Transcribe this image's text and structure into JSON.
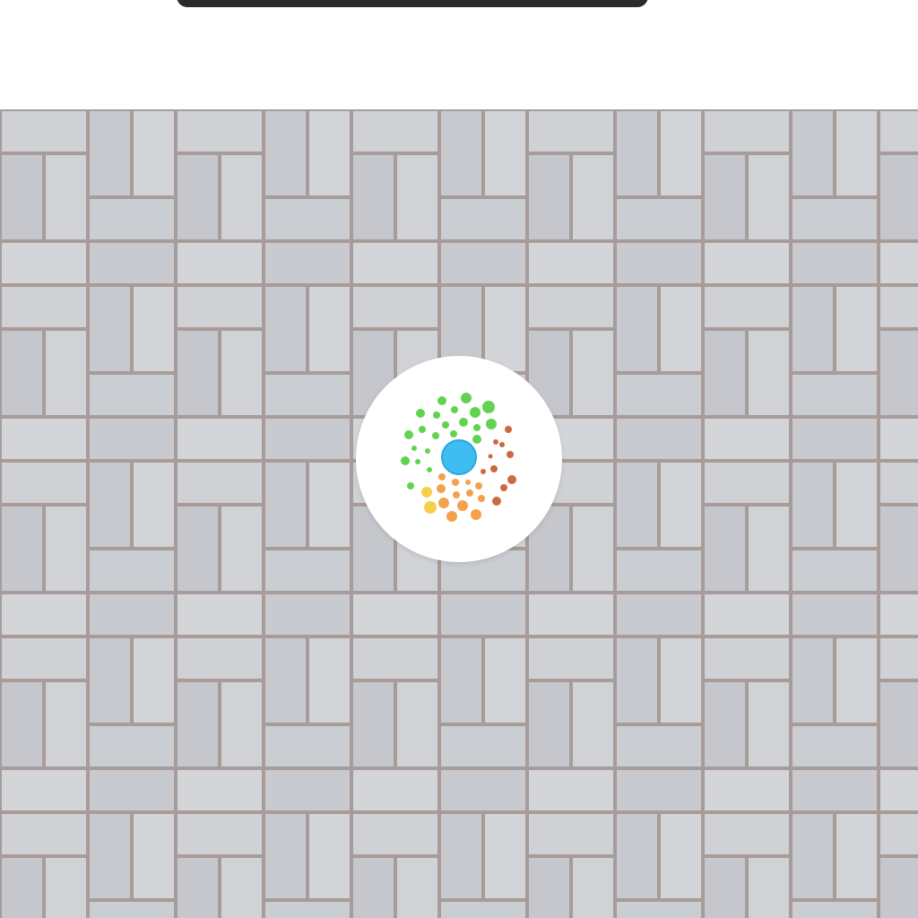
{
  "screen": {
    "top_bar": {
      "pill": "dark-notch"
    },
    "wallpaper": {
      "description_icon": "paving-brick-pattern",
      "base_color": "#c9cbcf",
      "brick_color": "#cfd1d5",
      "joint_color": "#a79c9a"
    },
    "app_icon": {
      "icon": "dot-burst-icon",
      "background": "#ffffff",
      "center_color": "#3fbcf2",
      "dot_colors": {
        "green": "#63d252",
        "orange": "#f4a24a",
        "red": "#cc6a3f",
        "yellow": "#f7d04a"
      }
    }
  }
}
